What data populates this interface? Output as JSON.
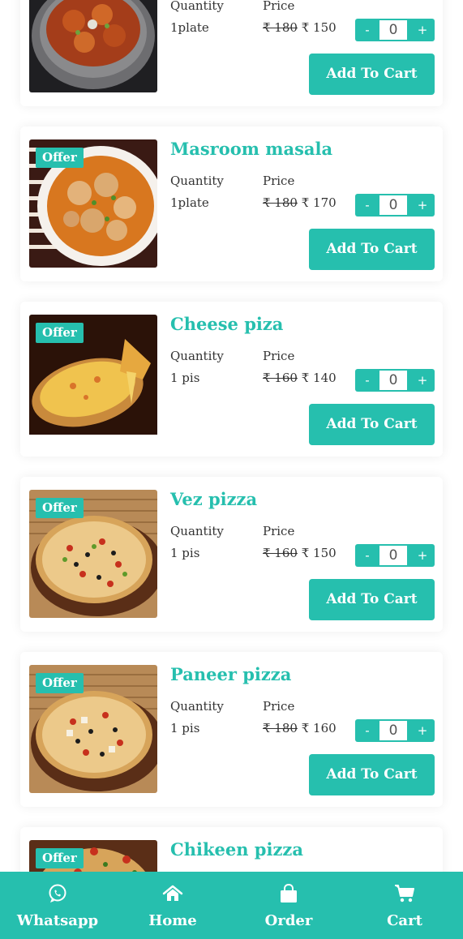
{
  "labels": {
    "quantity": "Quantity",
    "price": "Price",
    "offer": "Offer",
    "add_to_cart": "Add To Cart",
    "minus": "-",
    "plus": "+"
  },
  "colors": {
    "accent": "#26bfae",
    "text": "#333333"
  },
  "items": [
    {
      "title": "",
      "quantity": "1plate",
      "old_price": "₹ 180",
      "price": "₹ 150",
      "count": "0",
      "image": "curry-dish"
    },
    {
      "title": "Masroom masala",
      "quantity": "1plate",
      "old_price": "₹ 180",
      "price": "₹ 170",
      "count": "0",
      "image": "mushroom-masala"
    },
    {
      "title": "Cheese piza",
      "quantity": "1 pis",
      "old_price": "₹ 160",
      "price": "₹ 140",
      "count": "0",
      "image": "cheese-pizza"
    },
    {
      "title": "Vez pizza",
      "quantity": "1 pis",
      "old_price": "₹ 160",
      "price": "₹ 150",
      "count": "0",
      "image": "veg-pizza"
    },
    {
      "title": "Paneer pizza",
      "quantity": "1 pis",
      "old_price": "₹ 180",
      "price": "₹ 160",
      "count": "0",
      "image": "paneer-pizza"
    },
    {
      "title": "Chikeen pizza",
      "image": "chicken-pizza"
    }
  ],
  "nav": [
    {
      "label": "Whatsapp",
      "icon": "whatsapp-icon"
    },
    {
      "label": "Home",
      "icon": "home-icon"
    },
    {
      "label": "Order",
      "icon": "shopping-bag-icon"
    },
    {
      "label": "Cart",
      "icon": "cart-icon"
    }
  ]
}
